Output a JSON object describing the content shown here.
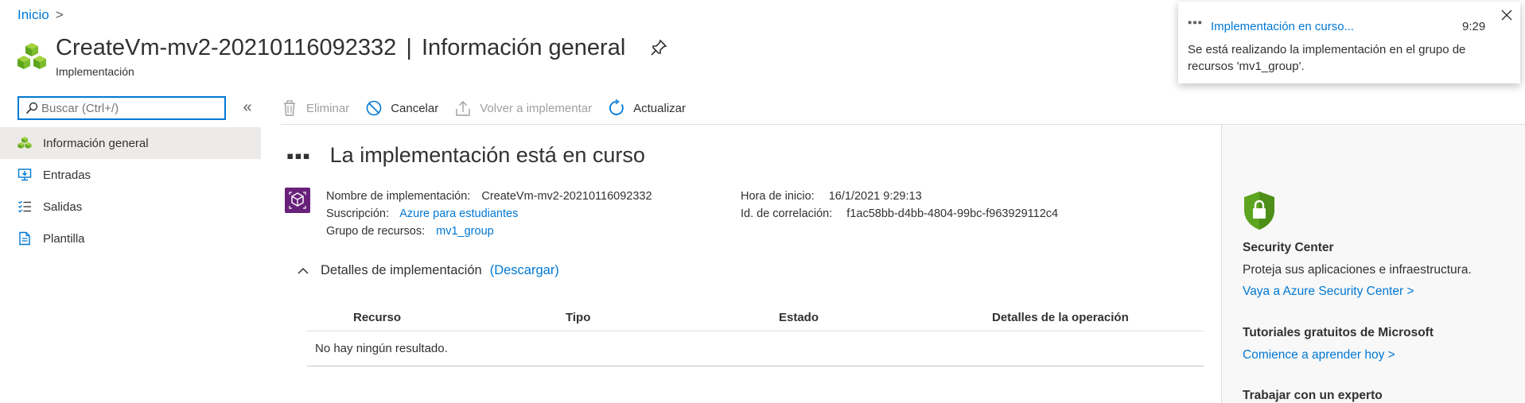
{
  "breadcrumb": {
    "home": "Inicio",
    "separator": ">"
  },
  "header": {
    "title_name": "CreateVm-mv2-20210116092332",
    "title_separator": "|",
    "title_section": "Información general",
    "subtitle": "Implementación",
    "icon": "resource-cubes-icon",
    "pin_icon": "pin-icon"
  },
  "search": {
    "placeholder": "Buscar (Ctrl+/)",
    "collapse": "«"
  },
  "sidebar": {
    "items": [
      {
        "label": "Información general",
        "icon": "overview-icon",
        "active": true
      },
      {
        "label": "Entradas",
        "icon": "inputs-icon"
      },
      {
        "label": "Salidas",
        "icon": "outputs-icon"
      },
      {
        "label": "Plantilla",
        "icon": "template-icon"
      }
    ]
  },
  "toolbar": {
    "delete": "Eliminar",
    "cancel": "Cancelar",
    "redeploy": "Volver a implementar",
    "refresh": "Actualizar"
  },
  "main": {
    "status_dots": "▪▪▪",
    "heading": "La implementación está en curso",
    "info": {
      "deployment_name_label": "Nombre de implementación:",
      "deployment_name": "CreateVm-mv2-20210116092332",
      "subscription_label": "Suscripción:",
      "subscription": "Azure para estudiantes",
      "resource_group_label": "Grupo de recursos:",
      "resource_group": "mv1_group",
      "start_time_label": "Hora de inicio:",
      "start_time": "16/1/2021 9:29:13",
      "correlation_label": "Id. de correlación:",
      "correlation_id": "f1ac58bb-d4bb-4804-99bc-f963929112c4"
    },
    "details": {
      "heading": "Detalles de implementación",
      "download": "(Descargar)",
      "columns": [
        "Recurso",
        "Tipo",
        "Estado",
        "Detalles de la operación"
      ],
      "empty": "No hay ningún resultado."
    }
  },
  "right_panel": {
    "security_title": "Security Center",
    "security_text": "Proteja sus aplicaciones e infraestructura.",
    "security_link": "Vaya a Azure Security Center >",
    "tutorials_title": "Tutoriales gratuitos de Microsoft",
    "tutorials_link": "Comience a aprender hoy >",
    "expert_title": "Trabajar con un experto"
  },
  "toast": {
    "dots": "▪▪▪",
    "title": "Implementación en curso...",
    "time": "9:29",
    "message": "Se está realizando la implementación en el grupo de recursos 'mv1_group'."
  },
  "colors": {
    "accent": "#0078d4",
    "active_nav": "#edebe9",
    "panel_bg": "#f8f8f8",
    "shield_green": "#5ea51f",
    "deploy_purple": "#68217a"
  }
}
